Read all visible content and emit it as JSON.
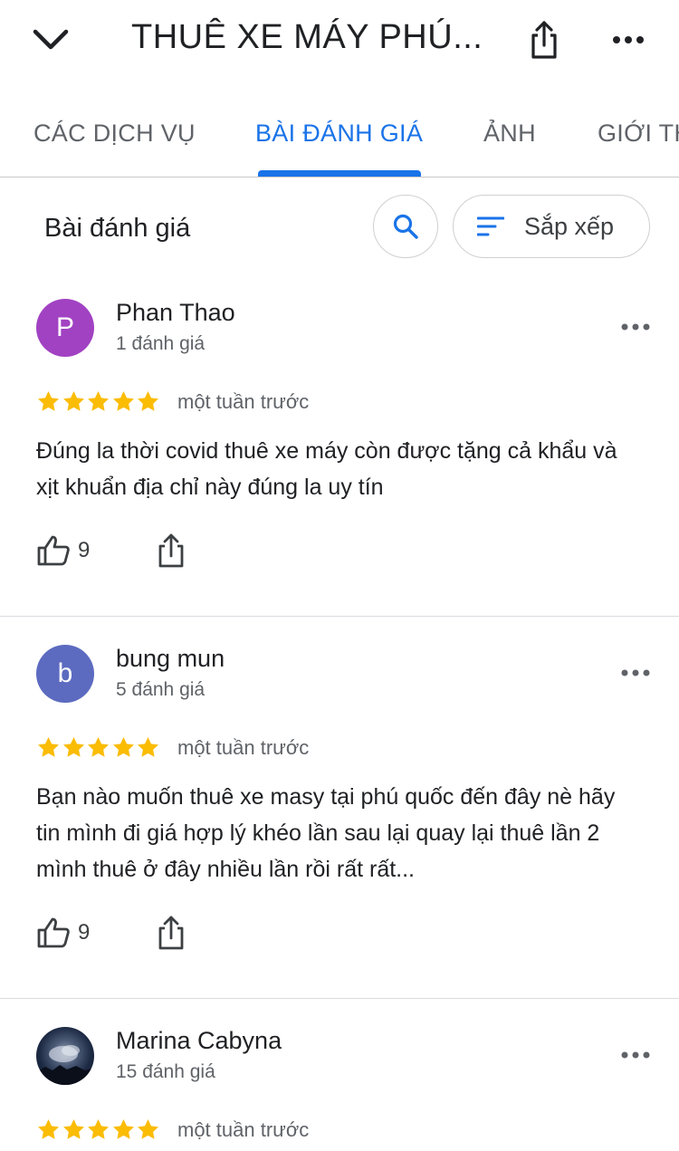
{
  "header": {
    "title": "THUÊ XE MÁY PHÚ...",
    "back_icon": "chevron-down-icon",
    "share_icon": "share-icon",
    "more_icon": "more-horizontal-icon"
  },
  "tabs": [
    {
      "label": "CÁC DỊCH VỤ",
      "active": false
    },
    {
      "label": "BÀI ĐÁNH GIÁ",
      "active": true
    },
    {
      "label": "ẢNH",
      "active": false
    },
    {
      "label": "GIỚI THIỆU",
      "active": false
    }
  ],
  "reviews_header": {
    "title": "Bài đánh giá",
    "search_icon": "search-icon",
    "sort_label": "Sắp xếp",
    "sort_icon": "sort-icon"
  },
  "reviews": [
    {
      "avatar_letter": "P",
      "avatar_color": "#a142c2",
      "author": "Phan Thao",
      "count": "1 đánh giá",
      "rating": 5,
      "time": "một tuần trước",
      "text": "Đúng la thời covid thuê xe máy còn được tặng cả khẩu và xịt khuẩn địa chỉ này đúng la uy tín",
      "likes": "9"
    },
    {
      "avatar_letter": "b",
      "avatar_color": "#5c6bc0",
      "author": "bung mun",
      "count": "5 đánh giá",
      "rating": 5,
      "time": "một tuần trước",
      "text": "Bạn nào muốn thuê xe masy tại phú quốc đến đây nè hãy tin mình đi giá hợp lý khéo lần sau lại quay lại thuê lần 2 mình thuê ở đây nhiều lần rồi rất rất...",
      "likes": "9"
    },
    {
      "avatar_letter": "",
      "avatar_color": "#1d2a44",
      "author": "Marina Cabyna",
      "count": "15 đánh giá",
      "rating": 5,
      "time": "một tuần trước"
    }
  ],
  "colors": {
    "accent": "#1a73e8",
    "star": "#fbbc04",
    "text": "#202124",
    "secondary_text": "#5f6368"
  }
}
